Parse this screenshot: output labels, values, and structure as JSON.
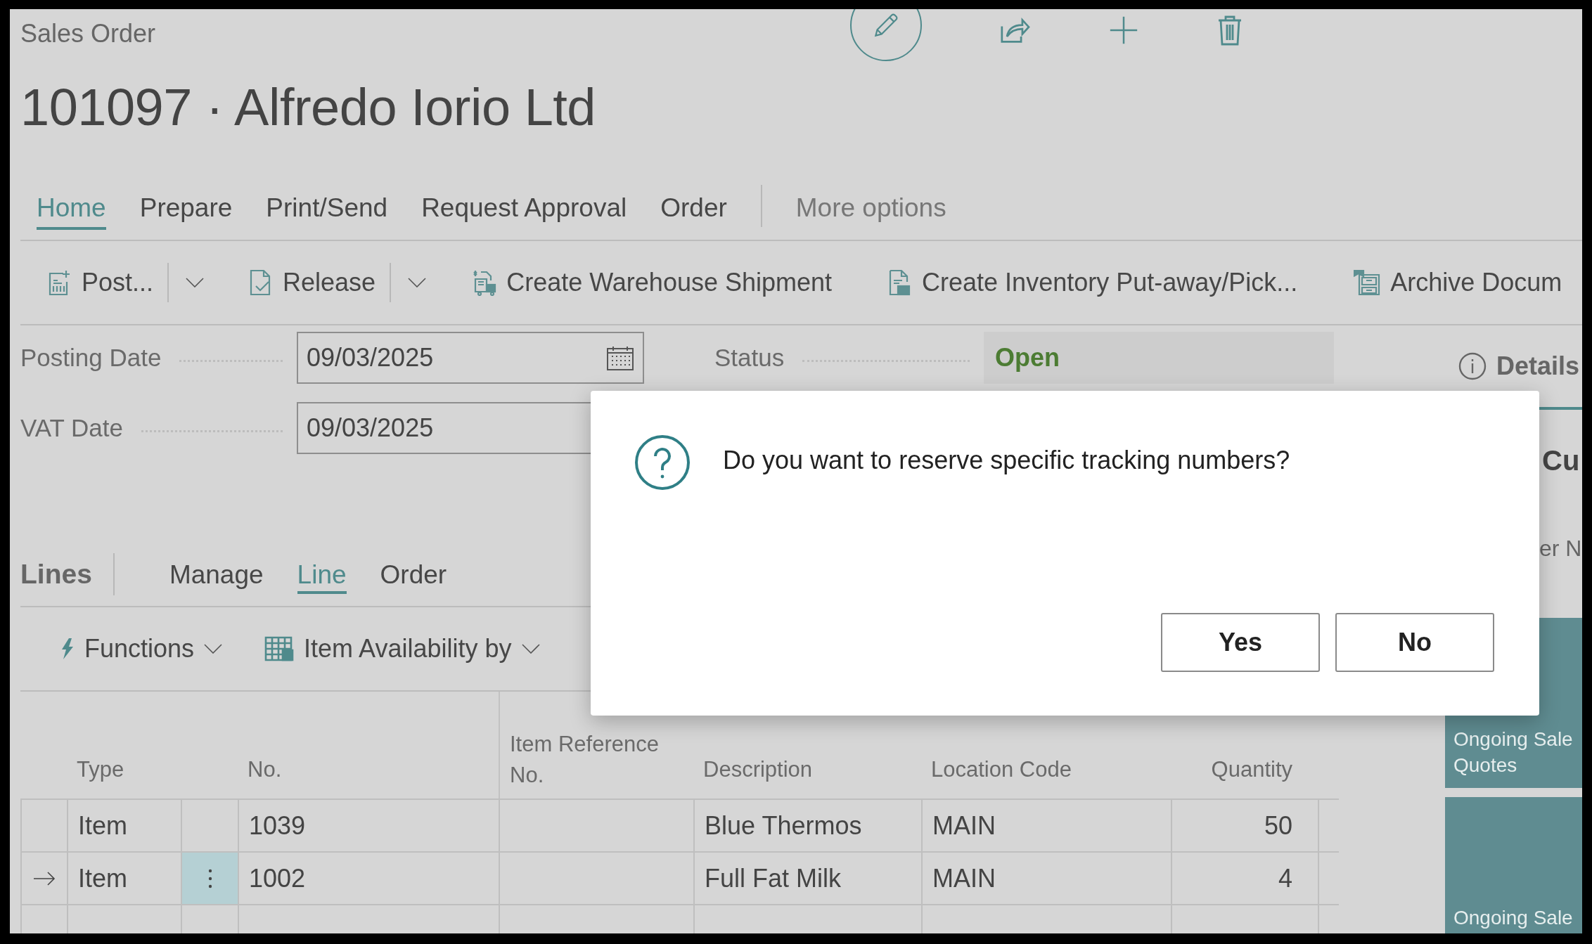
{
  "page_caption": "Sales Order",
  "title": "101097 · Alfredo Iorio Ltd",
  "tabs": [
    {
      "label": "Home",
      "selected": true
    },
    {
      "label": "Prepare",
      "selected": false
    },
    {
      "label": "Print/Send",
      "selected": false
    },
    {
      "label": "Request Approval",
      "selected": false
    },
    {
      "label": "Order",
      "selected": false
    }
  ],
  "more_options": "More options",
  "actions": [
    {
      "label": "Post...",
      "kind": "post",
      "dropdown": true
    },
    {
      "label": "Release",
      "kind": "release",
      "dropdown": true
    },
    {
      "label": "Create Warehouse Shipment",
      "kind": "shipment",
      "dropdown": false
    },
    {
      "label": "Create Inventory Put-away/Pick...",
      "kind": "inventory",
      "dropdown": false
    },
    {
      "label": "Archive Docum",
      "kind": "archive",
      "dropdown": false
    }
  ],
  "date_fields": [
    {
      "label": "Posting Date",
      "value": "09/03/2025",
      "calendar": true
    },
    {
      "label": "VAT Date",
      "value": "09/03/2025",
      "calendar": false
    }
  ],
  "status": {
    "label": "Status",
    "value": "Open"
  },
  "lines": {
    "title": "Lines",
    "tabs": [
      {
        "label": "Manage",
        "selected": false
      },
      {
        "label": "Line",
        "selected": true
      },
      {
        "label": "Order",
        "selected": false
      }
    ],
    "actions": [
      {
        "label": "Functions",
        "kind": "lightning"
      },
      {
        "label": "Item Availability by",
        "kind": "grid"
      }
    ],
    "columns": [
      "Type",
      "No.",
      "Item Reference No.",
      "Description",
      "Location Code",
      "Quantity"
    ],
    "rows": [
      {
        "current": false,
        "selected": false,
        "type": "Item",
        "no": "1039",
        "description": "Blue Thermos",
        "location_code": "MAIN",
        "quantity": "50"
      },
      {
        "current": true,
        "selected": true,
        "type": "Item",
        "no": "1002",
        "description": "Full Fat Milk",
        "location_code": "MAIN",
        "quantity": "4"
      }
    ]
  },
  "details": {
    "title": "Details",
    "heading": "Cu",
    "subtext": "er N",
    "tiles": [
      {
        "lines": [
          "Ongoing Sale",
          "Quotes"
        ]
      },
      {
        "lines": [
          "Ongoing Sale"
        ]
      }
    ]
  },
  "dialog": {
    "message": "Do you want to reserve specific tracking numbers?",
    "buttons": [
      "Yes",
      "No"
    ]
  }
}
